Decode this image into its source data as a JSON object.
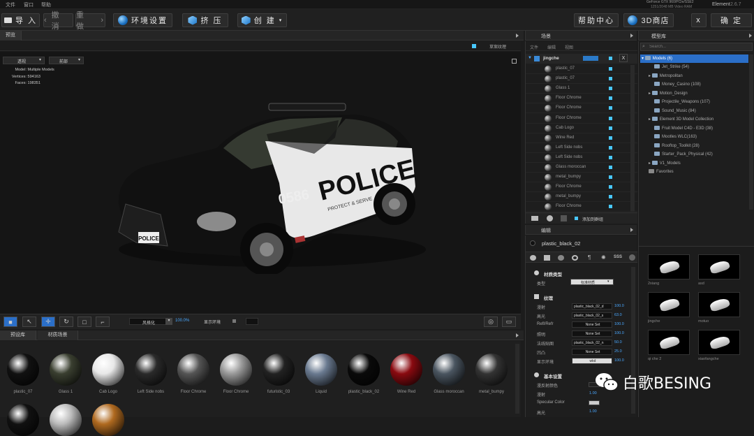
{
  "menubar": {
    "items": [
      "文件",
      "窗口",
      "帮助"
    ],
    "gpu_line1": "GeForce GTX 960/PCIe/SSE2",
    "gpu_line2": "1251/2048 MB Video RAM",
    "app": "Element",
    "version": "2.6.7"
  },
  "toolbar": {
    "import": "导 入",
    "undo": "撤 消",
    "redo": "重 做",
    "environment": "环境设置",
    "extrude": "挤 压",
    "create": "创 建",
    "help": "帮助中心",
    "store": "3D商店",
    "close": "x",
    "ok": "确 定"
  },
  "preview": {
    "title": "预览",
    "draft_label": "草案纹理",
    "mode_dropdown": "透视",
    "projection_dropdown": "前部",
    "info": [
      {
        "k": "Model:",
        "v": "Multiple Models"
      },
      {
        "k": "Vertices:",
        "v": "594163"
      },
      {
        "k": "Faces:",
        "v": "198351"
      }
    ],
    "car_number": "0586",
    "car_text": "POLICE",
    "car_sub": "PROTECT & SERVE",
    "plate_text": "POLICE",
    "style_dropdown": "风格化",
    "zoom": "100.0%",
    "show_env": "显示环境"
  },
  "matlib": {
    "tabs": [
      "预设库",
      "材质场景"
    ],
    "balls": [
      {
        "label": "plastic_07",
        "color": "#111"
      },
      {
        "label": "Glass 1",
        "color": "#3a3f30"
      },
      {
        "label": "Cab Logo",
        "color": "#e8e8e8"
      },
      {
        "label": "Left Side nobs",
        "color": "#2a2a2a"
      },
      {
        "label": "Floor Chrome",
        "color": "#555"
      },
      {
        "label": "Floor Chrome",
        "color": "#999"
      },
      {
        "label": "futuristic_03",
        "color": "#222"
      },
      {
        "label": "Liquid",
        "color": "#6a7a90"
      },
      {
        "label": "plastic_black_02",
        "color": "#0a0a0a"
      },
      {
        "label": "Wine Red",
        "color": "#8a0a10"
      },
      {
        "label": "Glass moroccan",
        "color": "#4a5560"
      },
      {
        "label": "metal_bumpy",
        "color": "#333"
      }
    ]
  },
  "scene": {
    "title": "场景",
    "menu": [
      "文件",
      "编辑",
      "视图"
    ],
    "root": "jingche",
    "root_close": "X",
    "rows": [
      "plastic_07",
      "plastic_07",
      "Glass 1",
      "Floor Chrome",
      "Floor Chrome",
      "Floor Chrome",
      "Cab Logo",
      "Wine Red",
      "Left Side nobs",
      "Left Side nobs",
      "Glass moroccan",
      "metal_bumpy",
      "Floor Chrome",
      "metal_bumpy",
      "Floor Chrome"
    ],
    "add_group": "添加到群组"
  },
  "editor": {
    "title": "编辑",
    "material": "plastic_black_02",
    "section_type": "材质类型",
    "type_label": "类型",
    "type_value": "标准材质",
    "section_tex": "纹理",
    "rows": [
      {
        "label": "漫射",
        "field": "plastic_black_02_d",
        "value": "100.0"
      },
      {
        "label": "高光",
        "field": "plastic_black_02_s",
        "value": "63.0"
      },
      {
        "label": "Refl/Refr",
        "field": "None Set",
        "value": "100.0"
      },
      {
        "label": "照明",
        "field": "None Set",
        "value": "100.0"
      },
      {
        "label": "法线贴图",
        "field": "plastic_black_02_n",
        "value": "50.0"
      },
      {
        "label": "凹凸",
        "field": "None Set",
        "value": "25.0"
      },
      {
        "label": "显示环境",
        "field": "wkd",
        "value": "100.0"
      }
    ],
    "section_basic": "基本设置",
    "basic": [
      {
        "label": "漫反射颜色",
        "value": ""
      },
      {
        "label": "漫射",
        "value": "1.00"
      },
      {
        "label": "Specular Color",
        "value": ""
      },
      {
        "label": "高光",
        "value": "1.00"
      }
    ]
  },
  "library": {
    "title": "模型库",
    "search_placeholder": "Search...",
    "root": "Models (6)",
    "items": [
      "Jet_Strike (54)",
      "Metropolitan",
      "Money_Casino (108)",
      "Motion_Design",
      "Projectile_Weapons (107)",
      "Sound_Music (84)",
      "Element 3D Model Collection",
      "Fruit Model C4D - E3D (38)",
      "Mootles WLC(163)",
      "Rooftop_Toolkit (28)",
      "Starter_Pack_Physical (42)",
      "V1_Models"
    ],
    "favorites": "Favorites"
  },
  "thumbs": [
    "2xiang",
    "asd",
    "jingche",
    "motuo",
    "qi che 2",
    "xiaofangche"
  ],
  "watermark": "白歌BESING"
}
